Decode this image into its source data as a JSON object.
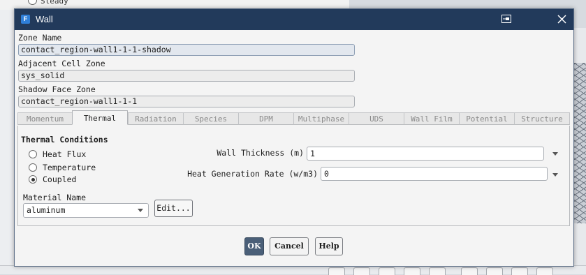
{
  "background": {
    "radio_label": "Steady"
  },
  "dialog": {
    "title": "Wall",
    "app_icon": "F",
    "fields": {
      "zone_name_label": "Zone Name",
      "zone_name_value": "contact_region-wall1-1-1-shadow",
      "adjacent_cell_zone_label": "Adjacent Cell Zone",
      "adjacent_cell_zone_value": "sys_solid",
      "shadow_face_zone_label": "Shadow Face Zone",
      "shadow_face_zone_value": "contact_region-wall1-1-1"
    },
    "tabs": [
      {
        "label": "Momentum",
        "selected": false
      },
      {
        "label": "Thermal",
        "selected": true
      },
      {
        "label": "Radiation",
        "selected": false
      },
      {
        "label": "Species",
        "selected": false
      },
      {
        "label": "DPM",
        "selected": false
      },
      {
        "label": "Multiphase",
        "selected": false
      },
      {
        "label": "UDS",
        "selected": false
      },
      {
        "label": "Wall Film",
        "selected": false
      },
      {
        "label": "Potential",
        "selected": false
      },
      {
        "label": "Structure",
        "selected": false
      }
    ],
    "thermal": {
      "group_title": "Thermal Conditions",
      "conditions": [
        {
          "label": "Heat Flux",
          "selected": false
        },
        {
          "label": "Temperature",
          "selected": false
        },
        {
          "label": "Coupled",
          "selected": true
        }
      ],
      "wall_thickness_label": "Wall Thickness (m)",
      "wall_thickness_value": "1",
      "heat_generation_label": "Heat Generation Rate (w/m3)",
      "heat_generation_value": "0",
      "material_name_label": "Material Name",
      "material_value": "aluminum",
      "edit_label": "Edit..."
    },
    "buttons": {
      "ok": "OK",
      "cancel": "Cancel",
      "help": "Help"
    }
  },
  "colors": {
    "titlebar": "#223a5b",
    "primary_button": "#4a5f78"
  }
}
